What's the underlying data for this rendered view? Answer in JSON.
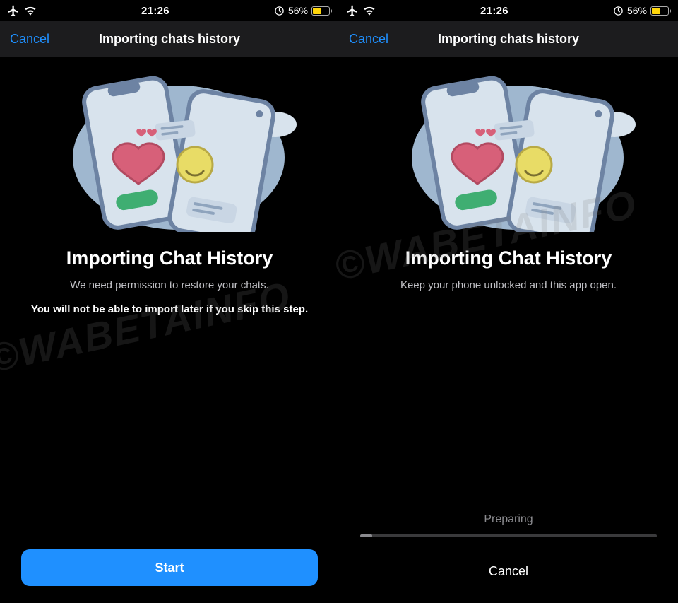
{
  "status": {
    "time": "21:26",
    "battery_percent": "56%",
    "battery_fill_pct": 56
  },
  "nav": {
    "cancel": "Cancel",
    "title": "Importing chats history"
  },
  "left": {
    "heading": "Importing Chat History",
    "desc": "We need permission to restore your chats.",
    "warn": "You will not be able to import later if you skip this step.",
    "start_btn": "Start"
  },
  "right": {
    "heading": "Importing Chat History",
    "desc": "Keep your phone unlocked and this app open.",
    "preparing": "Preparing",
    "cancel_btn": "Cancel",
    "progress_pct": 4
  },
  "watermark": "©WABETAINFO"
}
